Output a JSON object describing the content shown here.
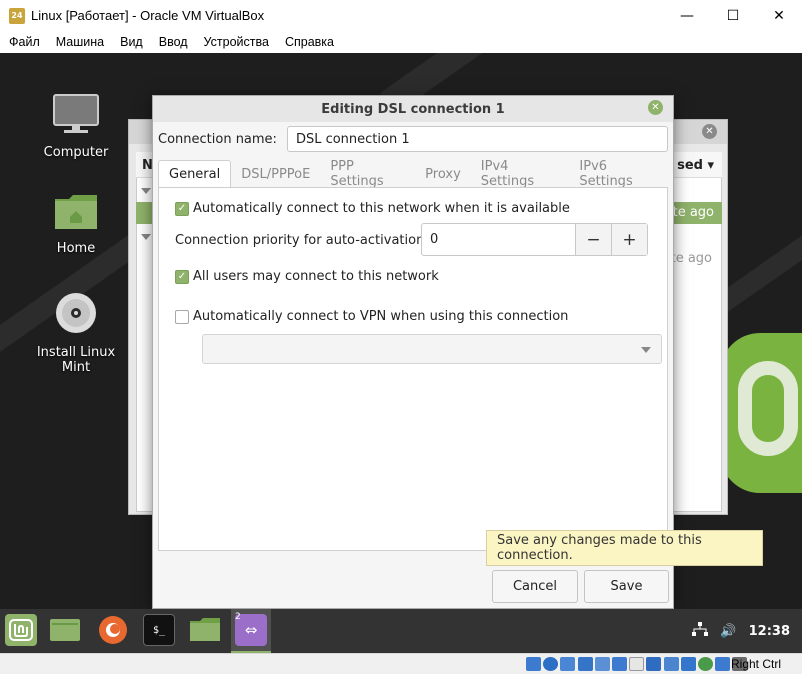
{
  "window": {
    "title": "Linux [Работает] - Oracle VM VirtualBox",
    "minimize": "—",
    "maximize": "☐",
    "close": "✕"
  },
  "menubar": [
    "Файл",
    "Машина",
    "Вид",
    "Ввод",
    "Устройства",
    "Справка"
  ],
  "desktop": {
    "icons": [
      {
        "label": "Computer",
        "icon": "monitor-icon"
      },
      {
        "label": "Home",
        "icon": "folder-icon"
      },
      {
        "label": "Install Linux Mint",
        "icon": "disc-icon"
      }
    ]
  },
  "bg_window": {
    "col_name_partial": "N",
    "col_used_partial": "sed ▾",
    "row1_time": "te ago",
    "row2_time": "te ago"
  },
  "dialog": {
    "title": "Editing DSL connection 1",
    "connection_name_label": "Connection name:",
    "connection_name_value": "DSL connection 1",
    "tabs": [
      "General",
      "DSL/PPPoE",
      "PPP Settings",
      "Proxy",
      "IPv4 Settings",
      "IPv6 Settings"
    ],
    "active_tab": "General",
    "auto_connect_label": "Automatically connect to this network when it is available",
    "auto_connect_checked": true,
    "priority_label": "Connection priority for auto-activation:",
    "priority_value": "0",
    "minus": "−",
    "plus": "+",
    "all_users_label": "All users may connect to this network",
    "all_users_checked": true,
    "vpn_label": "Automatically connect to VPN when using this connection",
    "vpn_checked": false,
    "vpn_select_value": "",
    "cancel": "Cancel",
    "save": "Save"
  },
  "tooltip": "Save any changes made to this connection.",
  "taskbar": {
    "badge": "2",
    "clock": "12:38"
  },
  "statusbar": {
    "host_key": "Right Ctrl"
  },
  "colors": {
    "accent": "#8fb36b",
    "tooltip_bg": "#fbf5c4",
    "desktop_bg": "#1e1e1e",
    "taskbar_bg": "#333333"
  }
}
